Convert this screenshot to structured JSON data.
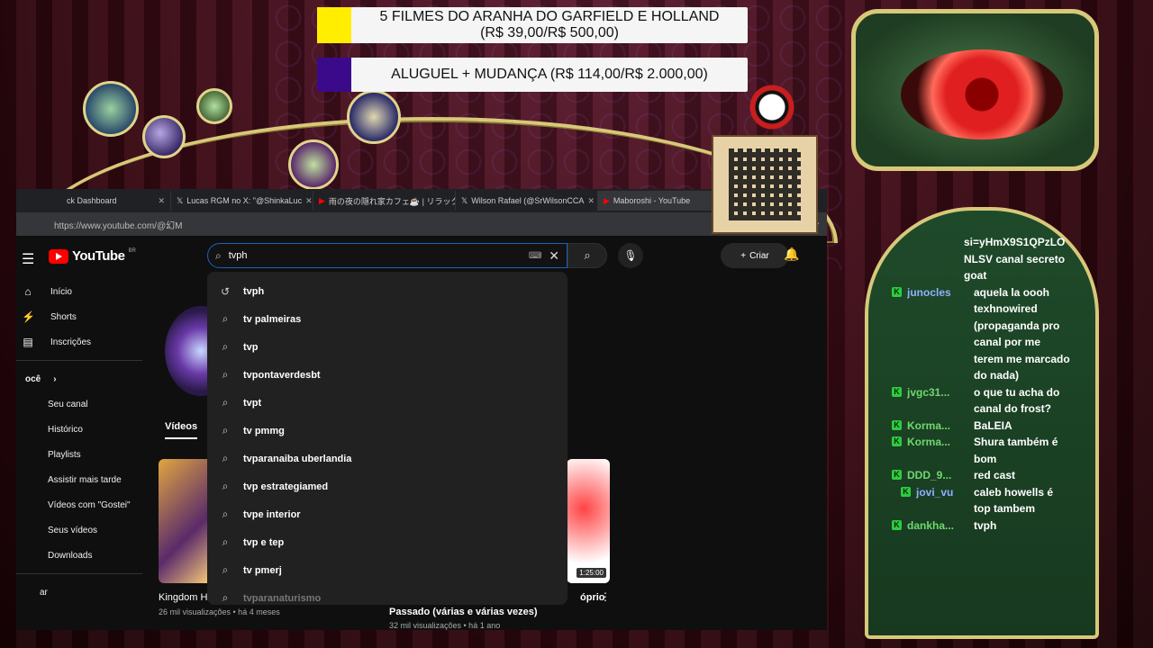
{
  "donations": [
    {
      "color": "#ffee00",
      "text_line1": "5 FILMES DO ARANHA DO GARFIELD E HOLLAND",
      "text_line2": "(R$ 39,00/R$ 500,00)"
    },
    {
      "color": "#3b0a8a",
      "text_line1": "ALUGUEL + MUDANÇA (R$ 114,00/R$ 2.000,00)"
    }
  ],
  "browser": {
    "tabs": [
      {
        "label": "ck Dashboard",
        "icon": "dashboard-icon"
      },
      {
        "label": "Lucas RGM no X: \"@ShinkaLuc",
        "icon": "x-logo-icon"
      },
      {
        "label": "雨の夜の隠れ家カフェ☕ | リラック",
        "icon": "youtube-icon"
      },
      {
        "label": "Wilson Rafael (@SrWilsonCCA",
        "icon": "x-logo-icon"
      },
      {
        "label": "Maboroshi - YouTube",
        "icon": "youtube-icon"
      }
    ],
    "url": "https://www.youtube.com/@幻M"
  },
  "youtube": {
    "logo_text": "YouTube",
    "country_code": "BR",
    "search_value": "tvph",
    "create_label": "Criar",
    "sidebar": {
      "main": [
        {
          "label": "Início",
          "icon": "home-icon"
        },
        {
          "label": "Shorts",
          "icon": "shorts-icon"
        },
        {
          "label": "Inscrições",
          "icon": "subscriptions-icon"
        }
      ],
      "section_title": "ocê",
      "you": [
        "Seu canal",
        "Histórico",
        "Playlists",
        "Assistir mais tarde",
        "Vídeos com \"Gostei\"",
        "Seus vídeos",
        "Downloads"
      ],
      "bottom": "ar"
    },
    "videos_tab": "Vídeos",
    "suggestions": [
      "tvph",
      "tv palmeiras",
      "tvp",
      "tvpontaverdesbt",
      "tvpt",
      "tv pmmg",
      "tvparanaiba uberlandia",
      "tvp estrategiamed",
      "tvpe interior",
      "tvp e tep",
      "tv pmerj",
      "tvparanaturismo"
    ],
    "videos": [
      {
        "title": "Kingdom H",
        "meta": "26 mil visualizações • há 4 meses"
      },
      {
        "title": "Passado (várias e várias vezes)",
        "meta": "32 mil visualizações • há 1 ano",
        "extra_title": "óprio",
        "duration": "1:25:00"
      }
    ]
  },
  "chat": [
    {
      "user": "",
      "text": "si=yHmX9S1QPzLO NLSV canal secreto goat"
    },
    {
      "user": "junocles",
      "color": "blue",
      "text": "aquela la oooh texhnowired (propaganda pro canal por me terem me marcado do nada)"
    },
    {
      "user": "jvgc31...",
      "color": "green",
      "text": "o que tu acha do canal do frost?"
    },
    {
      "user": "Korma...",
      "color": "green",
      "text": "BaLEIA"
    },
    {
      "user": "Korma...",
      "color": "green",
      "text": "Shura também é bom"
    },
    {
      "user": "DDD_9...",
      "color": "green",
      "text": "red cast"
    },
    {
      "user": "jovi_vu",
      "color": "blue",
      "text": "caleb howells é top tambem"
    },
    {
      "user": "dankha...",
      "color": "green",
      "text": "tvph"
    }
  ]
}
